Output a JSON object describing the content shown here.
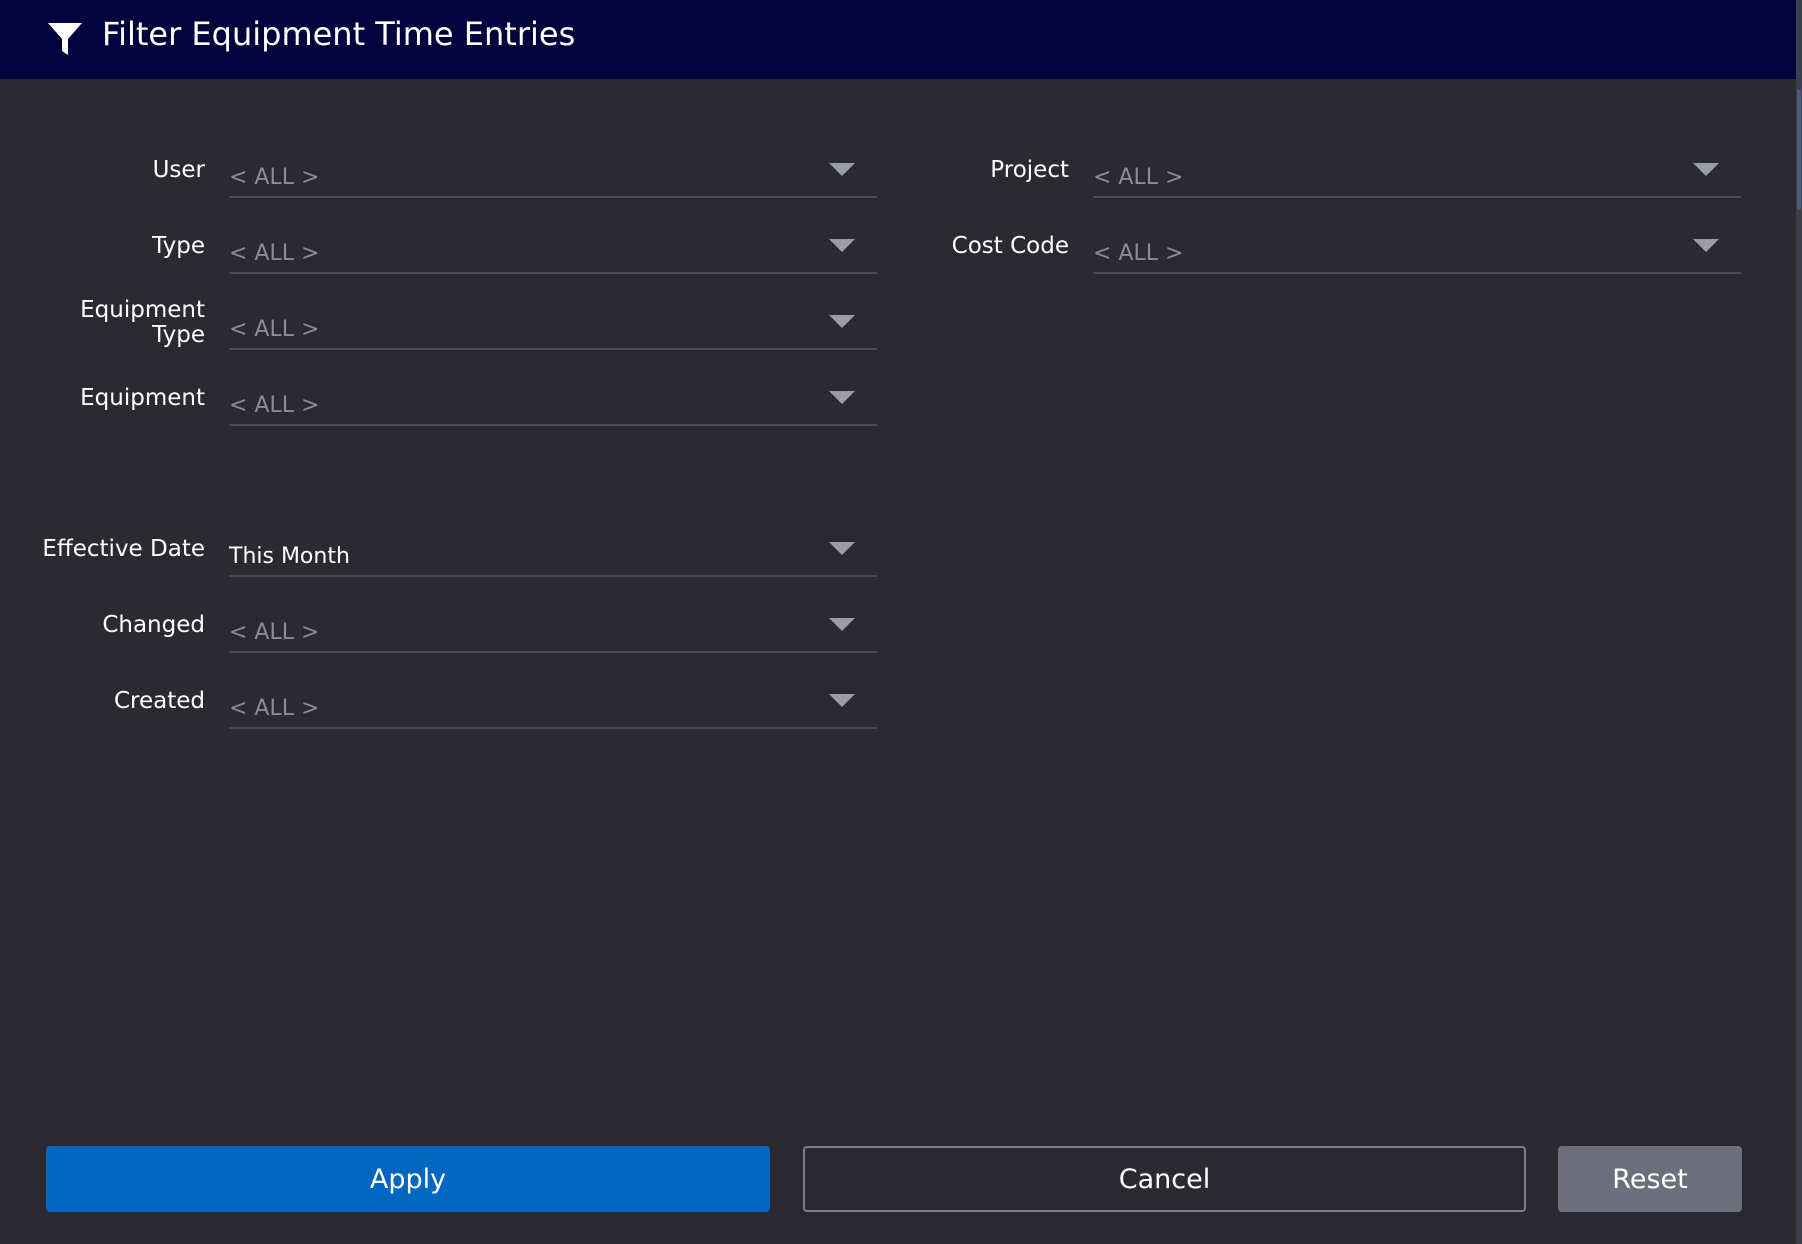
{
  "dialog": {
    "title": "Filter Equipment Time Entries",
    "header_icon": "filter-funnel-icon"
  },
  "filters": {
    "user": {
      "label": "User",
      "value": "< ALL >"
    },
    "type": {
      "label": "Type",
      "value": "< ALL >"
    },
    "equipment_type": {
      "label_line1": "Equipment",
      "label_line2": "Type",
      "value": "< ALL >"
    },
    "equipment": {
      "label": "Equipment",
      "value": "< ALL >"
    },
    "effective_date": {
      "label": "Effective Date",
      "value": "This Month"
    },
    "changed": {
      "label": "Changed",
      "value": "< ALL >"
    },
    "created": {
      "label": "Created",
      "value": "< ALL >"
    },
    "project": {
      "label": "Project",
      "value": "< ALL >"
    },
    "cost_code": {
      "label": "Cost Code",
      "value": "< ALL >"
    }
  },
  "buttons": {
    "apply": "Apply",
    "cancel": "Cancel",
    "reset": "Reset"
  },
  "colors": {
    "header_bg": "#02023c",
    "dialog_bg": "#2a2a30",
    "apply_bg": "#0366c0",
    "reset_bg": "#6e6f7c",
    "placeholder_text": "#8a8d96"
  }
}
